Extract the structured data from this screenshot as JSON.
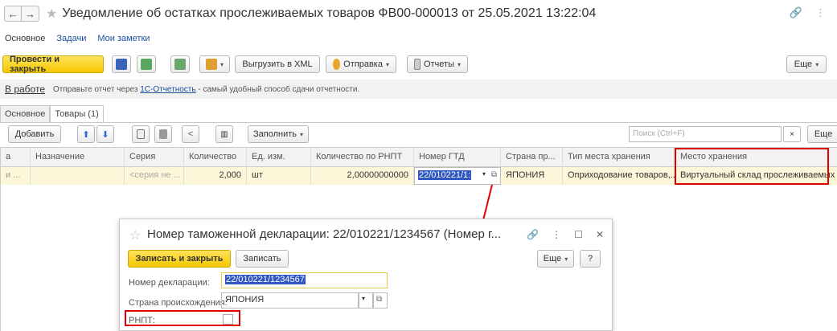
{
  "window": {
    "title": "Уведомление об остатках прослеживаемых товаров ФВ00-000013 от 25.05.2021 13:22:04"
  },
  "form_tabs": [
    "Основное",
    "Задачи",
    "Мои заметки"
  ],
  "toolbar": {
    "post_close": "Провести и закрыть",
    "export_xml": "Выгрузить в XML",
    "send": "Отправка",
    "reports": "Отчеты",
    "more": "Еще"
  },
  "info": {
    "status": "В работе",
    "msg_prefix": "Отправьте отчет через",
    "msg_link": "1С-Отчетность",
    "msg_suffix": "- самый удобный способ сдачи отчетности."
  },
  "page_tabs": [
    "Основное",
    "Товары (1)"
  ],
  "table_toolbar": {
    "add": "Добавить",
    "fill": "Заполнить",
    "search_placeholder": "Поиск (Ctrl+F)",
    "clear": "×",
    "more": "Еще"
  },
  "table": {
    "columns": [
      "а",
      "Назначение",
      "Серия",
      "Количество",
      "Ед. изм.",
      "Количество по РНПТ",
      "Номер ГТД",
      "Страна пр...",
      "Тип места хранения",
      "Место хранения"
    ],
    "row": {
      "c0": "и ...",
      "c1": "",
      "series": "<серия не ...",
      "qty": "2,000",
      "unit": "шт",
      "rnpt_qty": "2,00000000000",
      "gtd": "22/010221/1:",
      "country": "ЯПОНИЯ",
      "storage_type": "Оприходование товаров,...",
      "storage": "Виртуальный склад прослеживаемых"
    }
  },
  "dialog": {
    "title": "Номер таможенной декларации: 22/010221/1234567 (Номер г...",
    "save_close": "Записать и закрыть",
    "save": "Записать",
    "more": "Еще",
    "help": "?",
    "decl_label": "Номер декларации:",
    "decl_value": "22/010221/1234567",
    "country_label": "Страна происхождения:",
    "country_value": "ЯПОНИЯ",
    "rnpt_label": "РНПТ:"
  },
  "colors": {
    "accent_yellow": "#f5c800",
    "highlight_red": "#e00000",
    "selection_blue": "#3056c1",
    "link_blue": "#1a4fa0"
  }
}
